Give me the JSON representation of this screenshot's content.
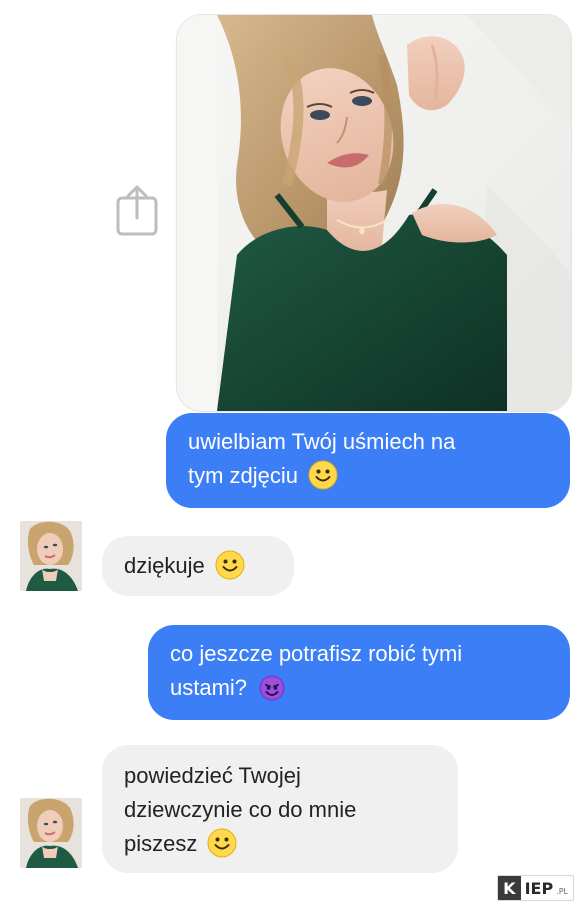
{
  "colors": {
    "outgoing": "#3c7ef6",
    "incoming": "#f0f0f0",
    "outgoing_text": "#ffffff",
    "incoming_text": "#222222"
  },
  "messages": [
    {
      "direction": "outgoing",
      "lines": [
        "uwielbiam Twój uśmiech na",
        "tym zdjęciu"
      ],
      "emoji": "smiley"
    },
    {
      "direction": "incoming",
      "lines": [
        "dziękuje"
      ],
      "emoji": "smiley"
    },
    {
      "direction": "outgoing",
      "lines": [
        "co jeszcze potrafisz robić tymi",
        "ustami?"
      ],
      "emoji": "smiling-imp"
    },
    {
      "direction": "incoming",
      "lines": [
        "powiedzieć Twojej",
        "dziewczynie co do mnie",
        "piszesz"
      ],
      "emoji": "smiley"
    }
  ],
  "shared_photo": {
    "icon": "share-icon"
  },
  "watermark": {
    "initial": "K",
    "main": "IEP",
    "suffix": ".PL"
  }
}
